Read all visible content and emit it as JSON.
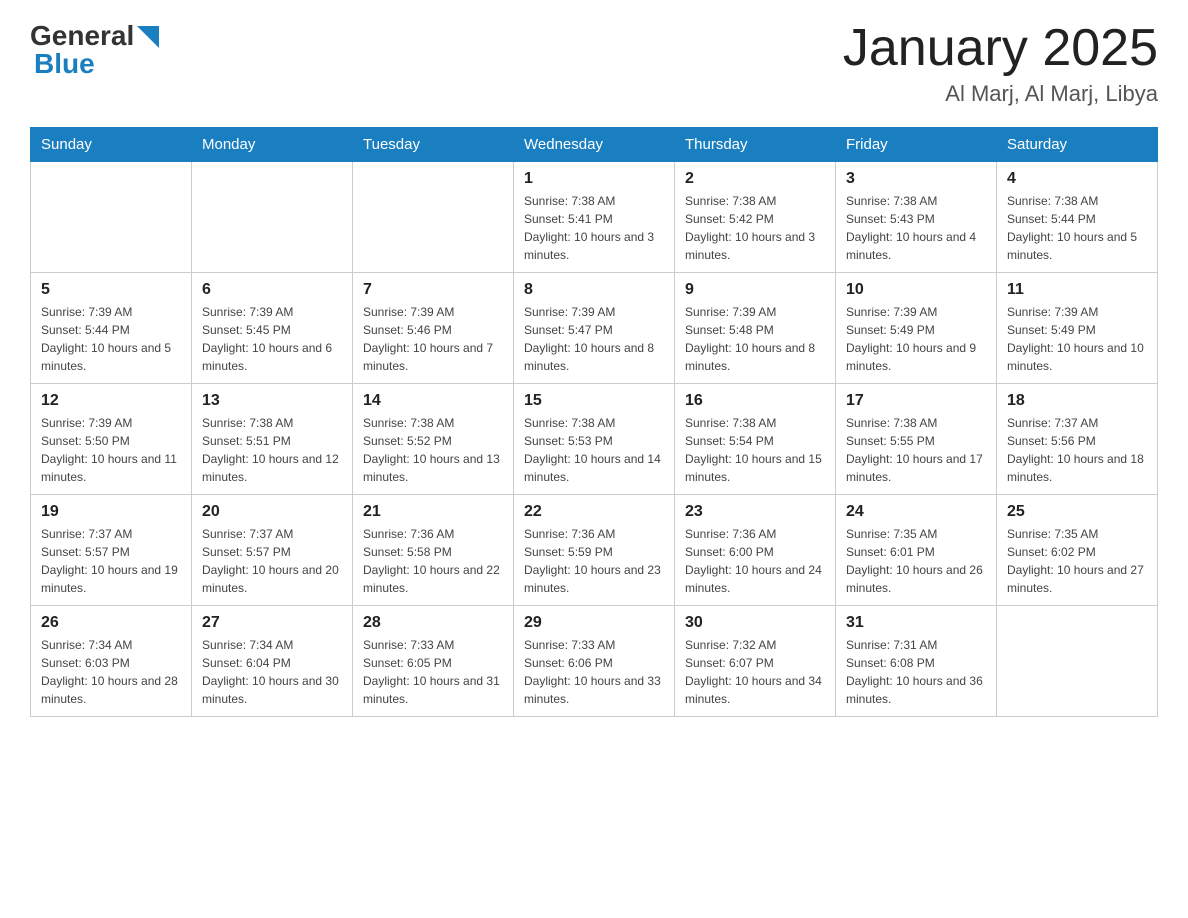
{
  "header": {
    "logo": {
      "text_general": "General",
      "text_blue": "Blue",
      "alt": "GeneralBlue Logo"
    },
    "title": "January 2025",
    "subtitle": "Al Marj, Al Marj, Libya"
  },
  "days_of_week": [
    "Sunday",
    "Monday",
    "Tuesday",
    "Wednesday",
    "Thursday",
    "Friday",
    "Saturday"
  ],
  "weeks": [
    [
      {
        "day": "",
        "info": ""
      },
      {
        "day": "",
        "info": ""
      },
      {
        "day": "",
        "info": ""
      },
      {
        "day": "1",
        "info": "Sunrise: 7:38 AM\nSunset: 5:41 PM\nDaylight: 10 hours and 3 minutes."
      },
      {
        "day": "2",
        "info": "Sunrise: 7:38 AM\nSunset: 5:42 PM\nDaylight: 10 hours and 3 minutes."
      },
      {
        "day": "3",
        "info": "Sunrise: 7:38 AM\nSunset: 5:43 PM\nDaylight: 10 hours and 4 minutes."
      },
      {
        "day": "4",
        "info": "Sunrise: 7:38 AM\nSunset: 5:44 PM\nDaylight: 10 hours and 5 minutes."
      }
    ],
    [
      {
        "day": "5",
        "info": "Sunrise: 7:39 AM\nSunset: 5:44 PM\nDaylight: 10 hours and 5 minutes."
      },
      {
        "day": "6",
        "info": "Sunrise: 7:39 AM\nSunset: 5:45 PM\nDaylight: 10 hours and 6 minutes."
      },
      {
        "day": "7",
        "info": "Sunrise: 7:39 AM\nSunset: 5:46 PM\nDaylight: 10 hours and 7 minutes."
      },
      {
        "day": "8",
        "info": "Sunrise: 7:39 AM\nSunset: 5:47 PM\nDaylight: 10 hours and 8 minutes."
      },
      {
        "day": "9",
        "info": "Sunrise: 7:39 AM\nSunset: 5:48 PM\nDaylight: 10 hours and 8 minutes."
      },
      {
        "day": "10",
        "info": "Sunrise: 7:39 AM\nSunset: 5:49 PM\nDaylight: 10 hours and 9 minutes."
      },
      {
        "day": "11",
        "info": "Sunrise: 7:39 AM\nSunset: 5:49 PM\nDaylight: 10 hours and 10 minutes."
      }
    ],
    [
      {
        "day": "12",
        "info": "Sunrise: 7:39 AM\nSunset: 5:50 PM\nDaylight: 10 hours and 11 minutes."
      },
      {
        "day": "13",
        "info": "Sunrise: 7:38 AM\nSunset: 5:51 PM\nDaylight: 10 hours and 12 minutes."
      },
      {
        "day": "14",
        "info": "Sunrise: 7:38 AM\nSunset: 5:52 PM\nDaylight: 10 hours and 13 minutes."
      },
      {
        "day": "15",
        "info": "Sunrise: 7:38 AM\nSunset: 5:53 PM\nDaylight: 10 hours and 14 minutes."
      },
      {
        "day": "16",
        "info": "Sunrise: 7:38 AM\nSunset: 5:54 PM\nDaylight: 10 hours and 15 minutes."
      },
      {
        "day": "17",
        "info": "Sunrise: 7:38 AM\nSunset: 5:55 PM\nDaylight: 10 hours and 17 minutes."
      },
      {
        "day": "18",
        "info": "Sunrise: 7:37 AM\nSunset: 5:56 PM\nDaylight: 10 hours and 18 minutes."
      }
    ],
    [
      {
        "day": "19",
        "info": "Sunrise: 7:37 AM\nSunset: 5:57 PM\nDaylight: 10 hours and 19 minutes."
      },
      {
        "day": "20",
        "info": "Sunrise: 7:37 AM\nSunset: 5:57 PM\nDaylight: 10 hours and 20 minutes."
      },
      {
        "day": "21",
        "info": "Sunrise: 7:36 AM\nSunset: 5:58 PM\nDaylight: 10 hours and 22 minutes."
      },
      {
        "day": "22",
        "info": "Sunrise: 7:36 AM\nSunset: 5:59 PM\nDaylight: 10 hours and 23 minutes."
      },
      {
        "day": "23",
        "info": "Sunrise: 7:36 AM\nSunset: 6:00 PM\nDaylight: 10 hours and 24 minutes."
      },
      {
        "day": "24",
        "info": "Sunrise: 7:35 AM\nSunset: 6:01 PM\nDaylight: 10 hours and 26 minutes."
      },
      {
        "day": "25",
        "info": "Sunrise: 7:35 AM\nSunset: 6:02 PM\nDaylight: 10 hours and 27 minutes."
      }
    ],
    [
      {
        "day": "26",
        "info": "Sunrise: 7:34 AM\nSunset: 6:03 PM\nDaylight: 10 hours and 28 minutes."
      },
      {
        "day": "27",
        "info": "Sunrise: 7:34 AM\nSunset: 6:04 PM\nDaylight: 10 hours and 30 minutes."
      },
      {
        "day": "28",
        "info": "Sunrise: 7:33 AM\nSunset: 6:05 PM\nDaylight: 10 hours and 31 minutes."
      },
      {
        "day": "29",
        "info": "Sunrise: 7:33 AM\nSunset: 6:06 PM\nDaylight: 10 hours and 33 minutes."
      },
      {
        "day": "30",
        "info": "Sunrise: 7:32 AM\nSunset: 6:07 PM\nDaylight: 10 hours and 34 minutes."
      },
      {
        "day": "31",
        "info": "Sunrise: 7:31 AM\nSunset: 6:08 PM\nDaylight: 10 hours and 36 minutes."
      },
      {
        "day": "",
        "info": ""
      }
    ]
  ]
}
